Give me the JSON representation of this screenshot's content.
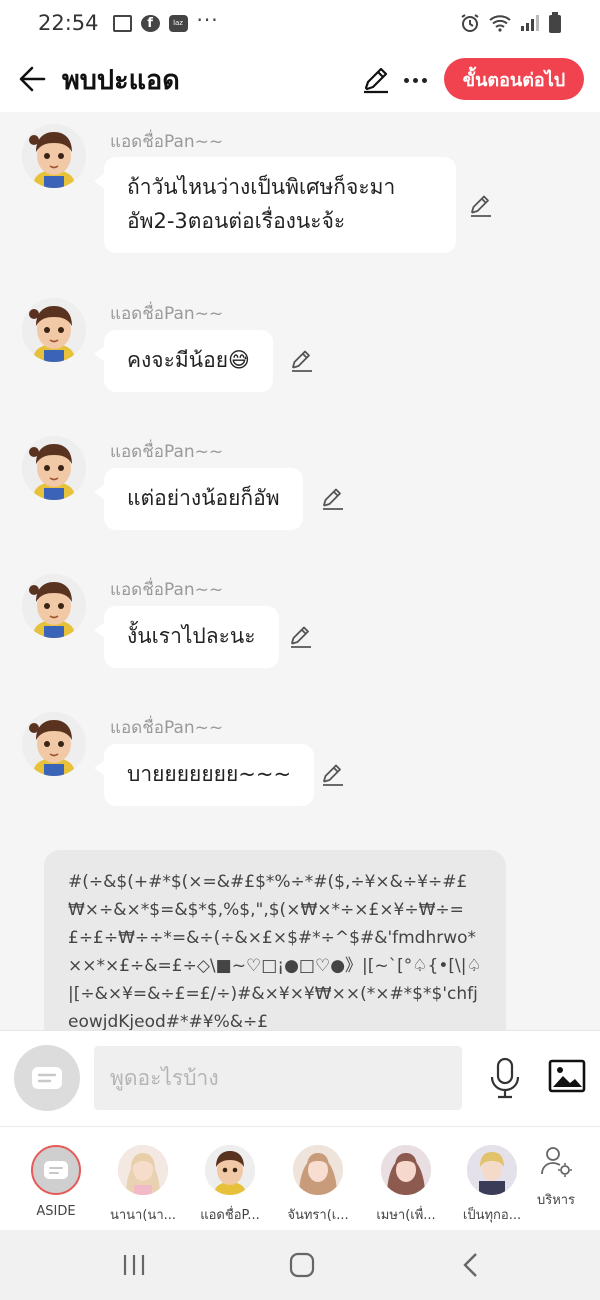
{
  "status_bar": {
    "time": "22:54",
    "laz_label": "laz"
  },
  "header": {
    "title": "พบปะแอด",
    "next_button": "ขั้นตอนต่อไป"
  },
  "messages": [
    {
      "sender": "แอดชื่อPan~~",
      "line1": "ถ้าวันไหนว่างเป็นพิเศษก็จะมา",
      "line2": "อัพ2-3ตอนต่อเรื่องนะจ้ะ"
    },
    {
      "sender": "แอดชื่อPan~~",
      "text": "คงจะมีน้อย😅"
    },
    {
      "sender": "แอดชื่อPan~~",
      "text": "แต่อย่างน้อยก็อัพ"
    },
    {
      "sender": "แอดชื่อPan~~",
      "text": "งั้นเราไปละนะ"
    },
    {
      "sender": "แอดชื่อPan~~",
      "text": "บายยยยยยย~~~"
    }
  ],
  "long_message": "#(÷&$(+#*$(×=&#£$*%÷*#($,÷¥×&÷¥÷#£₩×÷&×*$=&$*$,%$,\",$(×₩×*÷×£×¥÷₩÷=£÷£÷₩÷÷*=&÷(÷&×£×$#*÷^$#&'fmdhrwo*××*×£÷&=£÷◇\\■~♡□¡●□♡●》|[~`[°♤{•[\\|♤|[÷&×¥=&÷£=£/÷)#&×¥×¥₩××(*×#*$*$'chfjeowjdKjeod#*#¥%&÷£",
  "composer": {
    "placeholder": "พูดอะไรบ้าง"
  },
  "characters": [
    {
      "label": "ASIDE"
    },
    {
      "label": "นานา(นา..."
    },
    {
      "label": "แอดชื่อP..."
    },
    {
      "label": "จันทรา(เ..."
    },
    {
      "label": "เมษา(เพื่..."
    },
    {
      "label": "เป็นทุกอ..."
    }
  ],
  "manage_label": "บริหาร",
  "colors": {
    "accent": "#f0434f",
    "chat_bg": "#f5f5f5"
  }
}
